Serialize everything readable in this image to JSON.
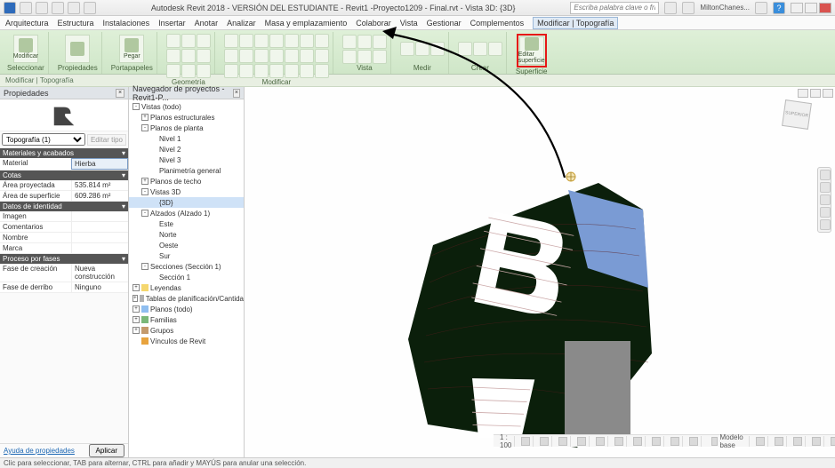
{
  "app": {
    "title": "Autodesk Revit 2018 - VERSIÓN DEL ESTUDIANTE -    Revit1 -Proyecto1209 - Final.rvt - Vista 3D: {3D}",
    "search_placeholder": "Escriba palabra clave o frase",
    "user": "MiltonChanes..."
  },
  "menu": {
    "items": [
      "Arquitectura",
      "Estructura",
      "Instalaciones",
      "Insertar",
      "Anotar",
      "Analizar",
      "Masa y emplazamiento",
      "Colaborar",
      "Vista",
      "Gestionar",
      "Complementos",
      "Modificar | Topografía"
    ],
    "active_index": 11
  },
  "ribbon": {
    "context_label": "Modificar | Topografía",
    "groups": [
      {
        "label": "Seleccionar",
        "big": [
          {
            "label": "Modificar"
          }
        ]
      },
      {
        "label": "Propiedades",
        "big": [
          {
            "label": ""
          }
        ]
      },
      {
        "label": "Portapapeles",
        "big": [
          {
            "label": "Pegar"
          }
        ]
      },
      {
        "label": "Geometría",
        "small_rows": 3
      },
      {
        "label": "Modificar",
        "small_rows": 3,
        "wide": true
      },
      {
        "label": "Vista",
        "small_rows": 2
      },
      {
        "label": "Medir",
        "small_rows": 1
      },
      {
        "label": "Crear",
        "small_rows": 1
      },
      {
        "label": "Superficie",
        "big": [
          {
            "label": "Editar superficie"
          }
        ],
        "highlight": true
      }
    ]
  },
  "properties": {
    "panel_title": "Propiedades",
    "type_selector": "Topografía (1)",
    "edit_type": "Editar tipo",
    "sections": [
      {
        "title": "Materiales y acabados",
        "rows": [
          {
            "k": "Material",
            "v": "Hierba",
            "selected": true
          }
        ]
      },
      {
        "title": "Cotas",
        "rows": [
          {
            "k": "Área proyectada",
            "v": "535.814 m²"
          },
          {
            "k": "Área de superficie",
            "v": "609.286 m²"
          }
        ]
      },
      {
        "title": "Datos de identidad",
        "rows": [
          {
            "k": "Imagen",
            "v": ""
          },
          {
            "k": "Comentarios",
            "v": ""
          },
          {
            "k": "Nombre",
            "v": ""
          },
          {
            "k": "Marca",
            "v": ""
          }
        ]
      },
      {
        "title": "Proceso por fases",
        "rows": [
          {
            "k": "Fase de creación",
            "v": "Nueva construcción"
          },
          {
            "k": "Fase de derribo",
            "v": "Ninguno"
          }
        ]
      }
    ],
    "help_link": "Ayuda de propiedades",
    "apply": "Aplicar"
  },
  "browser": {
    "panel_title": "Navegador de proyectos - Revit1-P...",
    "nodes": [
      {
        "l": "Vistas (todo)",
        "d": 0,
        "t": "-"
      },
      {
        "l": "Planos estructurales",
        "d": 1,
        "t": "+"
      },
      {
        "l": "Planos de planta",
        "d": 1,
        "t": "-"
      },
      {
        "l": "Nivel 1",
        "d": 2
      },
      {
        "l": "Nivel 2",
        "d": 2
      },
      {
        "l": "Nivel 3",
        "d": 2
      },
      {
        "l": "Planimetría general",
        "d": 2
      },
      {
        "l": "Planos de techo",
        "d": 1,
        "t": "+"
      },
      {
        "l": "Vistas 3D",
        "d": 1,
        "t": "-"
      },
      {
        "l": "{3D}",
        "d": 2,
        "sel": true
      },
      {
        "l": "Alzados (Alzado 1)",
        "d": 1,
        "t": "-"
      },
      {
        "l": "Este",
        "d": 2
      },
      {
        "l": "Norte",
        "d": 2
      },
      {
        "l": "Oeste",
        "d": 2
      },
      {
        "l": "Sur",
        "d": 2
      },
      {
        "l": "Secciones (Sección 1)",
        "d": 1,
        "t": "-"
      },
      {
        "l": "Sección 1",
        "d": 2
      },
      {
        "l": "Leyendas",
        "d": 0,
        "t": "+",
        "ic": "#f5d76e"
      },
      {
        "l": "Tablas de planificación/Cantida",
        "d": 0,
        "t": "+",
        "ic": "#b0b0b0"
      },
      {
        "l": "Planos (todo)",
        "d": 0,
        "t": "+",
        "ic": "#8fbef0"
      },
      {
        "l": "Familias",
        "d": 0,
        "t": "+",
        "ic": "#7ab87a"
      },
      {
        "l": "Grupos",
        "d": 0,
        "t": "+",
        "ic": "#c49a6c"
      },
      {
        "l": "Vínculos de Revit",
        "d": 0,
        "ic": "#e8a33d"
      }
    ]
  },
  "view_status": {
    "scale": "1 : 100",
    "worksets": "Modelo base"
  },
  "statusbar": {
    "hint": "Clic para seleccionar, TAB para alternar, CTRL para añadir y MAYÚS para anular una selección."
  },
  "viewcube": {
    "face": "SUPERIOR"
  },
  "chart_data": null
}
